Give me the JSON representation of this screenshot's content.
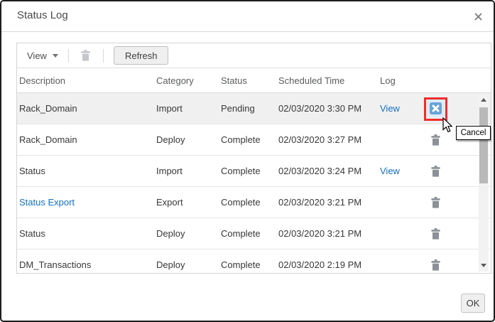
{
  "dialog": {
    "title": "Status Log",
    "ok_label": "OK"
  },
  "toolbar": {
    "view_label": "View",
    "refresh_label": "Refresh"
  },
  "table": {
    "columns": [
      "Description",
      "Category",
      "Status",
      "Scheduled Time",
      "Log"
    ],
    "rows": [
      {
        "description": "Rack_Domain",
        "category": "Import",
        "status": "Pending",
        "time": "02/03/2020 3:30 PM",
        "log": "View",
        "action": "cancel"
      },
      {
        "description": "Rack_Domain",
        "category": "Deploy",
        "status": "Complete",
        "time": "02/03/2020 3:27 PM",
        "log": "",
        "action": "delete"
      },
      {
        "description": "Status",
        "category": "Import",
        "status": "Complete",
        "time": "02/03/2020 3:24 PM",
        "log": "View",
        "action": "delete"
      },
      {
        "description": "Status Export",
        "category": "Export",
        "status": "Complete",
        "time": "02/03/2020 3:21 PM",
        "log": "",
        "action": "delete"
      },
      {
        "description": "Status",
        "category": "Deploy",
        "status": "Complete",
        "time": "02/03/2020 3:21 PM",
        "log": "",
        "action": "delete"
      },
      {
        "description": "DM_Transactions",
        "category": "Deploy",
        "status": "Complete",
        "time": "02/03/2020 2:19 PM",
        "log": "",
        "action": "delete"
      }
    ]
  },
  "tooltip": {
    "text": "Cancel"
  },
  "icons": {
    "close": "x",
    "view_caret": "chevron-down",
    "delete": "trash",
    "cancel": "x-in-blue-square",
    "scroll_up": "triangle-up",
    "scroll_down": "triangle-down",
    "cursor": "arrow-pointer"
  },
  "colors": {
    "link": "#1470c0",
    "annotation_red": "#ee2c2c",
    "cancel_blue": "#68a3d8",
    "selected_row_bg": "#f0f0f0"
  }
}
